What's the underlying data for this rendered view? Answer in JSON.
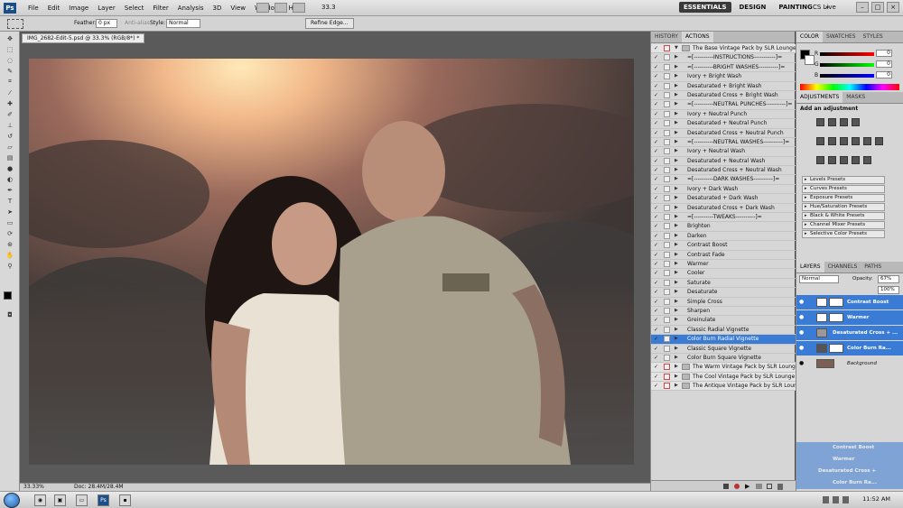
{
  "app": {
    "logo": "Ps"
  },
  "menu": [
    "File",
    "Edit",
    "Image",
    "Layer",
    "Select",
    "Filter",
    "Analysis",
    "3D",
    "View",
    "Window",
    "Help"
  ],
  "zoom_display": "33.3",
  "workspaces": [
    "ESSENTIALS",
    "DESIGN",
    "PAINTING"
  ],
  "workspace_more": "»",
  "cs_live": "CS Live",
  "options": {
    "feather_label": "Feather:",
    "feather_value": "0 px",
    "antialias_label": "Anti-alias",
    "style_label": "Style:",
    "style_value": "Normal",
    "refine_edge": "Refine Edge..."
  },
  "document": {
    "tab_title": "IMG_2682-Edit-5.psd @ 33.3% (RGB/8*) *",
    "zoom": "33.33%",
    "doc_info": "Doc: 28.4M/28.4M"
  },
  "actions_panel": {
    "tabs": [
      "HISTORY",
      "ACTIONS"
    ],
    "rows": [
      {
        "name": "The Base Vintage Pack by SLR Lounge",
        "type": "set"
      },
      {
        "name": "=[----------INSTRUCTIONS-----------]=",
        "type": "item"
      },
      {
        "name": "=[----------BRIGHT WASHES----------]=",
        "type": "item"
      },
      {
        "name": "Ivory + Bright Wash",
        "type": "item"
      },
      {
        "name": "Desaturated + Bright Wash",
        "type": "item"
      },
      {
        "name": "Desaturated Cross + Bright Wash",
        "type": "item"
      },
      {
        "name": "=[----------NEUTRAL PUNCHES----------]=",
        "type": "item"
      },
      {
        "name": "Ivory + Neutral Punch",
        "type": "item"
      },
      {
        "name": "Desaturated + Neutral Punch",
        "type": "item"
      },
      {
        "name": "Desaturated Cross + Neutral Punch",
        "type": "item"
      },
      {
        "name": "=[----------NEUTRAL WASHES----------]=",
        "type": "item"
      },
      {
        "name": "Ivory + Neutral Wash",
        "type": "item"
      },
      {
        "name": "Desaturated + Neutral Wash",
        "type": "item"
      },
      {
        "name": "Desaturated Cross + Neutral Wash",
        "type": "item"
      },
      {
        "name": "=[----------DARK WASHES----------]=",
        "type": "item"
      },
      {
        "name": "Ivory + Dark Wash",
        "type": "item"
      },
      {
        "name": "Desaturated + Dark Wash",
        "type": "item"
      },
      {
        "name": "Desaturated Cross + Dark Wash",
        "type": "item"
      },
      {
        "name": "=[----------TWEAKS----------]=",
        "type": "item"
      },
      {
        "name": "Brighten",
        "type": "item"
      },
      {
        "name": "Darken",
        "type": "item"
      },
      {
        "name": "Contrast Boost",
        "type": "item"
      },
      {
        "name": "Contrast Fade",
        "type": "item"
      },
      {
        "name": "Warmer",
        "type": "item"
      },
      {
        "name": "Cooler",
        "type": "item"
      },
      {
        "name": "Saturate",
        "type": "item"
      },
      {
        "name": "Desaturate",
        "type": "item"
      },
      {
        "name": "Simple Cross",
        "type": "item"
      },
      {
        "name": "Sharpen",
        "type": "item"
      },
      {
        "name": "Greinulate",
        "type": "item"
      },
      {
        "name": "Classic Radial Vignette",
        "type": "item"
      },
      {
        "name": "Color Burn Radial Vignette",
        "type": "selected"
      },
      {
        "name": "Classic Square Vignette",
        "type": "item"
      },
      {
        "name": "Color Burn Square Vignette",
        "type": "item"
      },
      {
        "name": "The Warm Vintage Pack by SLR Lounge",
        "type": "set"
      },
      {
        "name": "The Cool Vintage Pack by SLR Lounge",
        "type": "set"
      },
      {
        "name": "The Antique Vintage Pack by SLR Lounge",
        "type": "set"
      }
    ]
  },
  "color_panel": {
    "tabs": [
      "COLOR",
      "SWATCHES",
      "STYLES"
    ],
    "r_label": "R",
    "g_label": "G",
    "b_label": "B",
    "r": "0",
    "g": "0",
    "b": "0"
  },
  "adjustments_panel": {
    "tabs": [
      "ADJUSTMENTS",
      "MASKS"
    ],
    "title": "Add an adjustment",
    "presets": [
      "Levels Presets",
      "Curves Presets",
      "Exposure Presets",
      "Hue/Saturation Presets",
      "Black & White Presets",
      "Channel Mixer Presets",
      "Selective Color Presets"
    ]
  },
  "layers_panel": {
    "tabs": [
      "LAYERS",
      "CHANNELS",
      "PATHS"
    ],
    "blend_mode": "Normal",
    "opacity_label": "Opacity:",
    "opacity": "67%",
    "fill": "100%",
    "layers": [
      {
        "name": "Contrast Boost",
        "selected": true
      },
      {
        "name": "Warmer",
        "selected": true
      },
      {
        "name": "Desaturated Cross + ...",
        "selected": true
      },
      {
        "name": "Color Burn Ra...",
        "selected": true
      },
      {
        "name": "Background",
        "selected": false
      }
    ],
    "ghost_layers": [
      "Contrast Boost",
      "Warmer",
      "Desaturated Cross +",
      "Color Burn Ra..."
    ]
  },
  "taskbar": {
    "clock": "11:52 AM"
  }
}
